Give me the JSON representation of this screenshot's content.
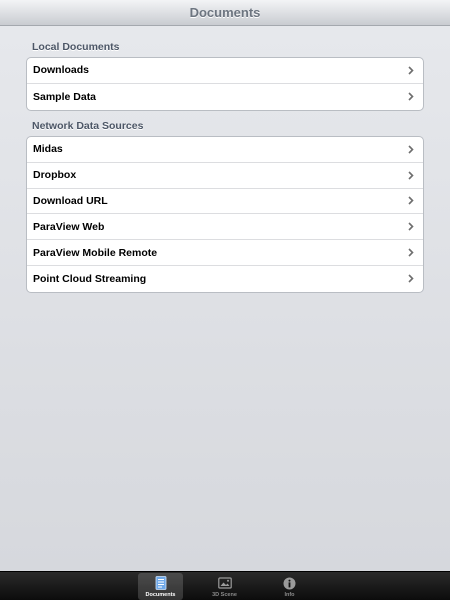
{
  "navbar": {
    "title": "Documents"
  },
  "sections": [
    {
      "header": "Local Documents",
      "items": [
        {
          "label": "Downloads"
        },
        {
          "label": "Sample Data"
        }
      ]
    },
    {
      "header": "Network Data Sources",
      "items": [
        {
          "label": "Midas"
        },
        {
          "label": "Dropbox"
        },
        {
          "label": "Download URL"
        },
        {
          "label": "ParaView Web"
        },
        {
          "label": "ParaView Mobile Remote"
        },
        {
          "label": "Point Cloud Streaming"
        }
      ]
    }
  ],
  "tabbar": {
    "tabs": [
      {
        "label": "Documents",
        "icon": "documents-icon",
        "selected": true
      },
      {
        "label": "3D Scene",
        "icon": "image-icon",
        "selected": false
      },
      {
        "label": "Info",
        "icon": "info-icon",
        "selected": false
      }
    ]
  },
  "colors": {
    "background": "#dfe1e6",
    "section_header": "#4c5666",
    "navbar_title": "#6d7580",
    "tabbar": "#111111"
  }
}
